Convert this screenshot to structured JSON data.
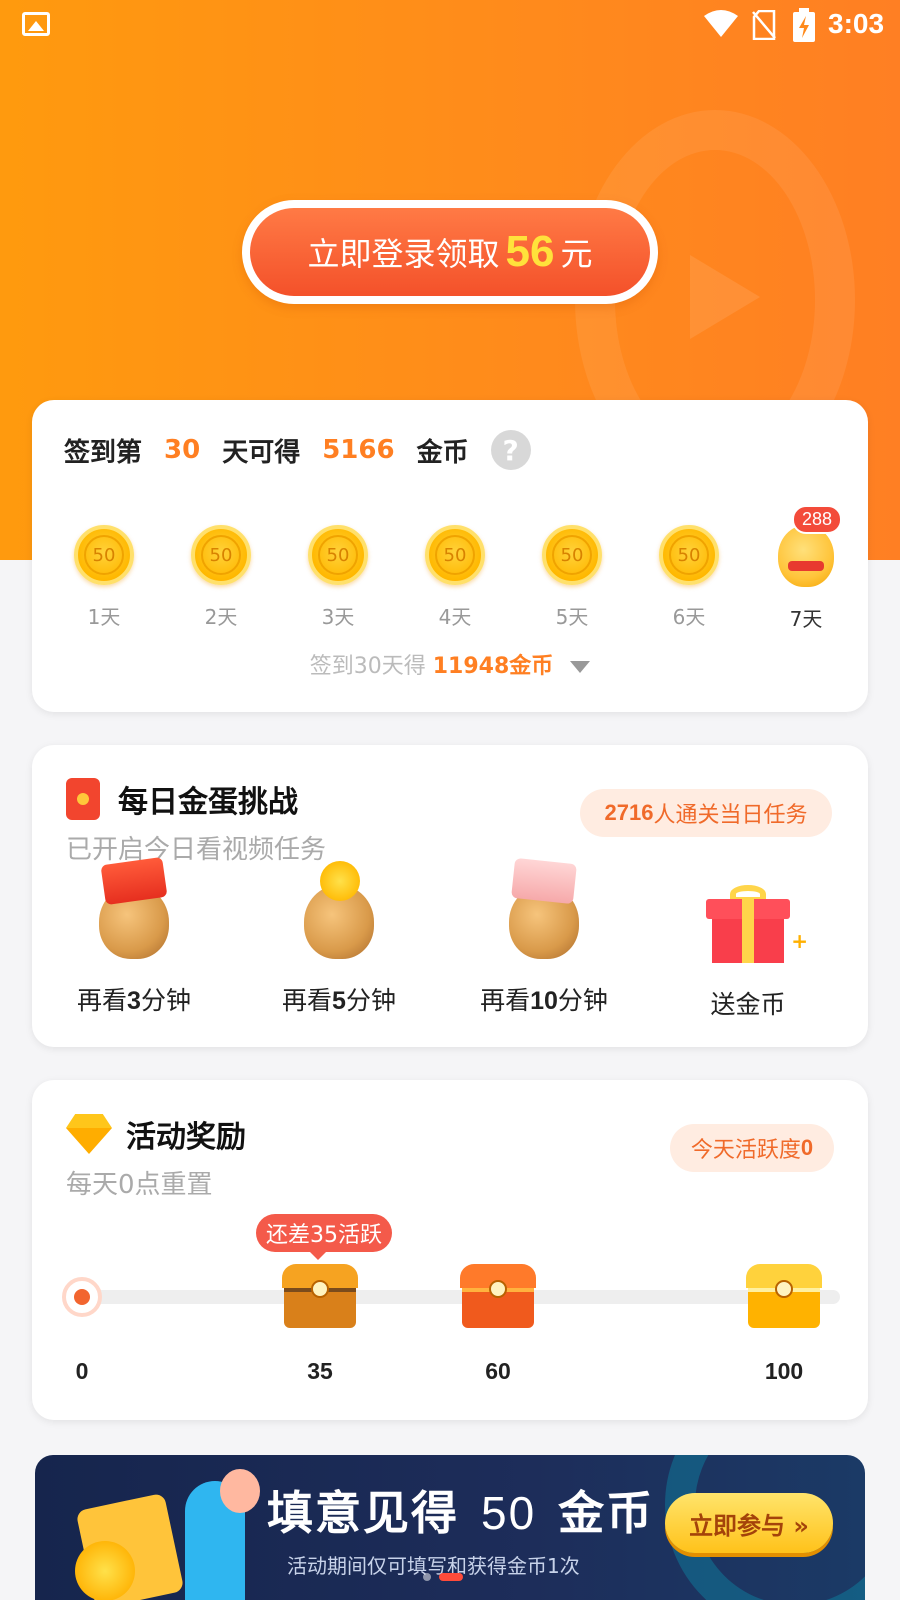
{
  "status_bar": {
    "time": "3:03"
  },
  "hero": {
    "login_prefix": "立即登录领取",
    "login_amount": "56",
    "login_unit": "元"
  },
  "checkin": {
    "prefix": "签到第",
    "day_count": "30",
    "middle": "天可得",
    "coin_total": "5166",
    "suffix": "金币",
    "help_symbol": "?",
    "days": [
      {
        "value": "50",
        "label": "1天"
      },
      {
        "value": "50",
        "label": "2天"
      },
      {
        "value": "50",
        "label": "3天"
      },
      {
        "value": "50",
        "label": "4天"
      },
      {
        "value": "50",
        "label": "5天"
      },
      {
        "value": "50",
        "label": "6天"
      },
      {
        "value": "288",
        "label": "7天"
      }
    ],
    "footer_prefix": "签到30天得",
    "footer_highlight": "11948金币"
  },
  "egg_challenge": {
    "title": "每日金蛋挑战",
    "subtitle": "已开启今日看视频任务",
    "pill_count": "2716",
    "pill_text": "人通关当日任务",
    "items": [
      {
        "prefix": "再看",
        "num": "3",
        "suffix": "分钟"
      },
      {
        "prefix": "再看",
        "num": "5",
        "suffix": "分钟"
      },
      {
        "prefix": "再看",
        "num": "10",
        "suffix": "分钟"
      },
      {
        "prefix": "送金币",
        "num": "",
        "suffix": ""
      }
    ],
    "plus_symbol": "+"
  },
  "activity": {
    "title": "活动奖励",
    "subtitle": "每天0点重置",
    "pill_text": "今天活跃度",
    "pill_value": "0",
    "tooltip": "还差35活跃",
    "current_activity": 0,
    "ticks": [
      "0",
      "35",
      "60",
      "100"
    ]
  },
  "banner": {
    "title_part1": "填意见得",
    "title_num": "50",
    "title_part2": "金币",
    "subtitle": "活动期间仅可填写和获得金币1次",
    "button": "立即参与 »",
    "page_count": 2,
    "active_page": 2
  }
}
